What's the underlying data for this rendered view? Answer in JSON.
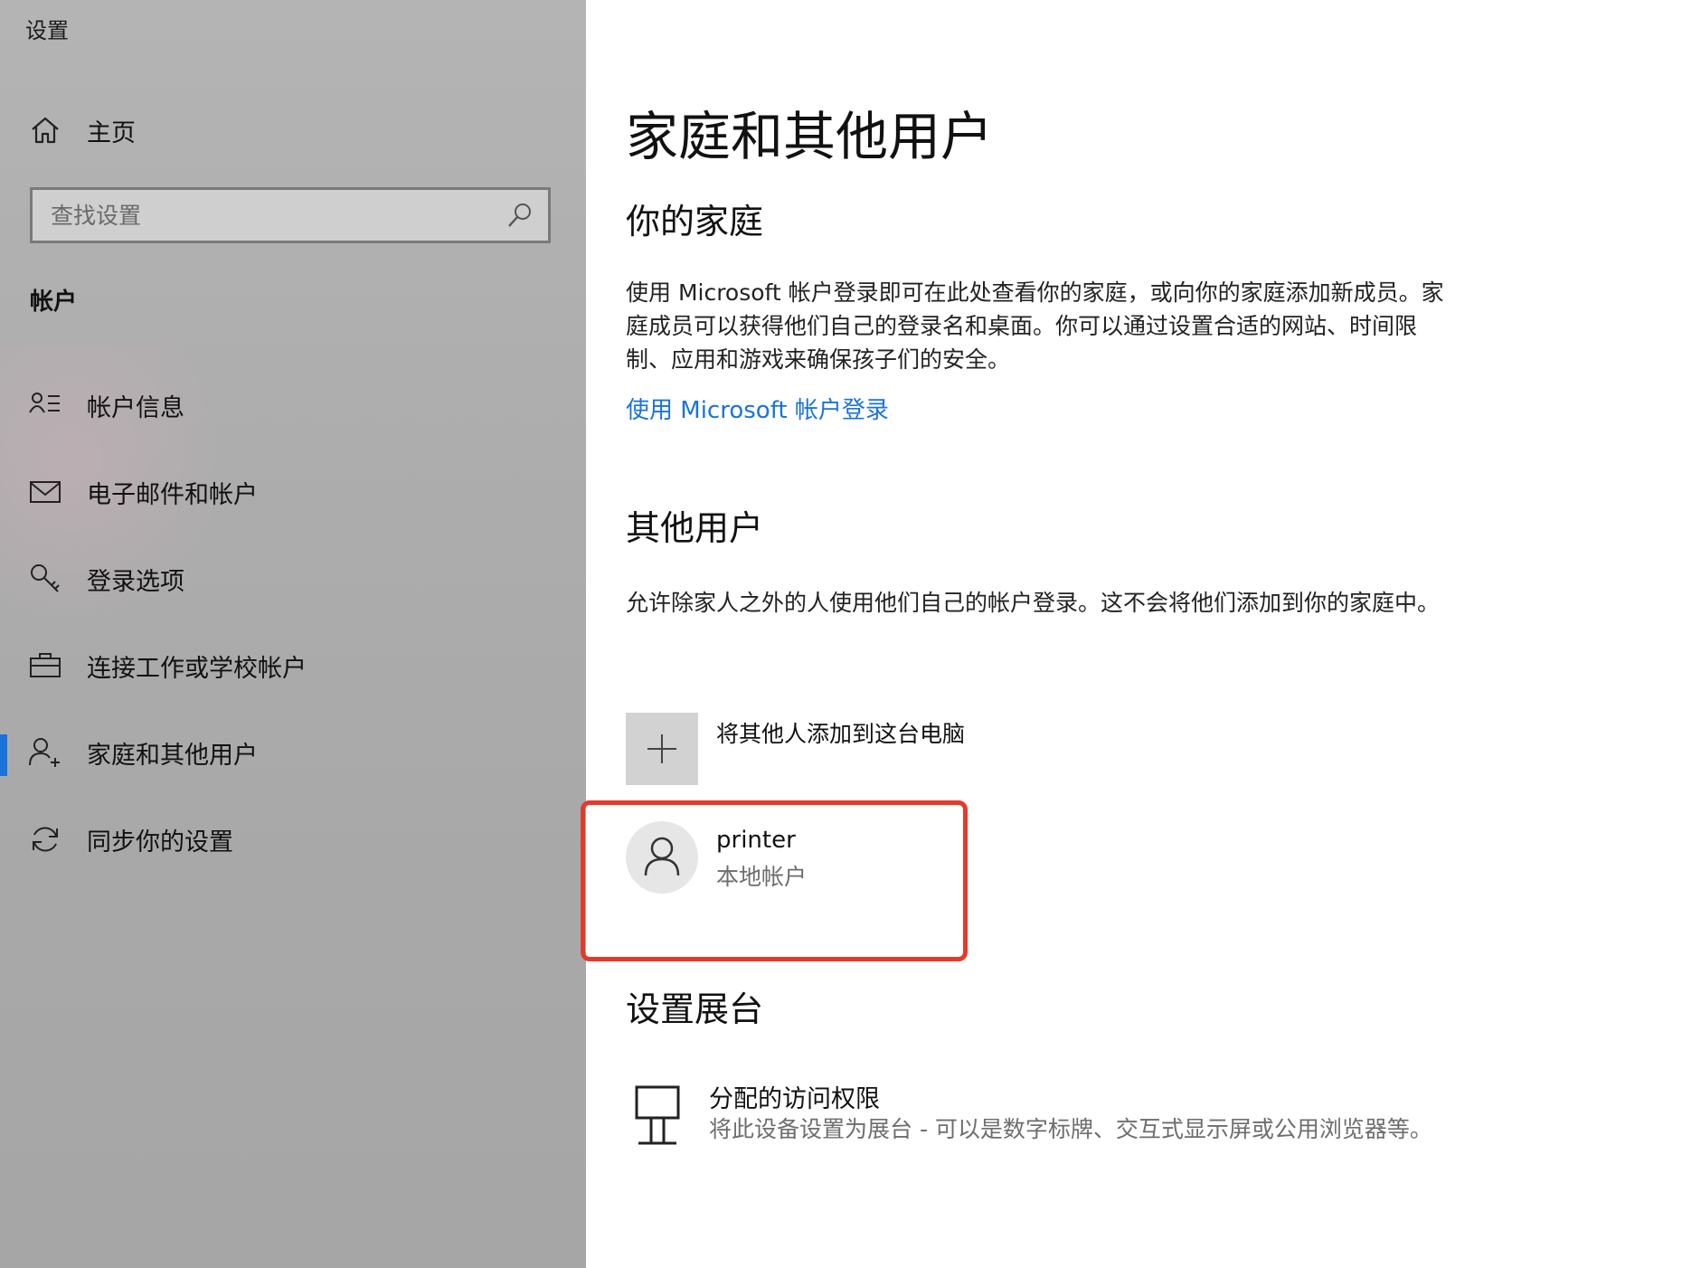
{
  "window": {
    "title": "设置"
  },
  "sidebar": {
    "home_label": "主页",
    "search_placeholder": "查找设置",
    "section_header": "帐户",
    "items": [
      {
        "label": "帐户信息",
        "icon": "account-info-icon",
        "selected": false
      },
      {
        "label": "电子邮件和帐户",
        "icon": "mail-icon",
        "selected": false
      },
      {
        "label": "登录选项",
        "icon": "key-icon",
        "selected": false
      },
      {
        "label": "连接工作或学校帐户",
        "icon": "briefcase-icon",
        "selected": false
      },
      {
        "label": "家庭和其他用户",
        "icon": "person-add-icon",
        "selected": true
      },
      {
        "label": "同步你的设置",
        "icon": "sync-icon",
        "selected": false
      }
    ]
  },
  "main": {
    "title": "家庭和其他用户",
    "family": {
      "heading": "你的家庭",
      "description": "使用 Microsoft 帐户登录即可在此处查看你的家庭，或向你的家庭添加新成员。家庭成员可以获得他们自己的登录名和桌面。你可以通过设置合适的网站、时间限制、应用和游戏来确保孩子们的安全。",
      "link": "使用 Microsoft 帐户登录"
    },
    "other_users": {
      "heading": "其他用户",
      "description": "允许除家人之外的人使用他们自己的帐户登录。这不会将他们添加到你的家庭中。",
      "add_label": "将其他人添加到这台电脑",
      "users": [
        {
          "name": "printer",
          "type": "本地帐户"
        }
      ]
    },
    "kiosk": {
      "heading": "设置展台",
      "title": "分配的访问权限",
      "description": "将此设备设置为展台 - 可以是数字标牌、交互式显示屏或公用浏览器等。"
    }
  },
  "colors": {
    "accent": "#1a73d9",
    "highlight_border": "#e53a2a",
    "sidebar_bg": "#adadad"
  }
}
